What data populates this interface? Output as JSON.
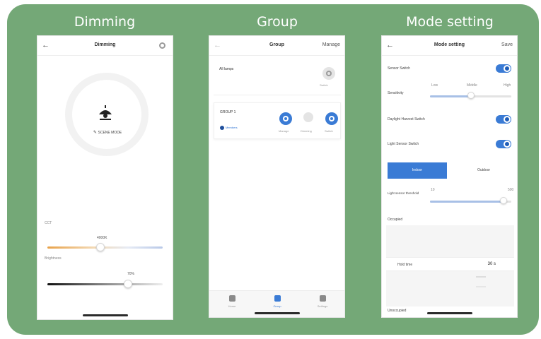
{
  "panels": {
    "dimming": {
      "title": "Dimming",
      "screen_title": "Dimming",
      "scene_label": "SCENE MODE",
      "slider1_label": "CCT",
      "slider1_value": "4000K",
      "slider1_level": 0.46,
      "slider2_label": "Brightness",
      "slider2_value": "70%",
      "slider2_level": 0.7,
      "icons": [
        "back-arrow-icon",
        "gear-icon",
        "lamp-icon"
      ]
    },
    "group": {
      "title": "Group",
      "screen_title": "Group",
      "manage_label": "Manage",
      "all_lamps_label": "All lamps",
      "all_lamps_action": "Switch",
      "group_name": "GROUP 1",
      "group_sub": "Members",
      "actions": [
        "Manage",
        "Dimming",
        "Switch"
      ],
      "tabs": [
        "Home",
        "Group",
        "Settings"
      ],
      "active_tab": "Group",
      "accent": "#3a7bd5"
    },
    "mode": {
      "title": "Mode setting",
      "screen_title": "Mode setting",
      "save_label": "Save",
      "sensor_switch": "Sensor Switch",
      "sensitivity": "Sensitivity",
      "sensitivity_levels": [
        "Low",
        "Middle",
        "High"
      ],
      "sensitivity_level": 0.5,
      "daylight": "Daylight Harvest Switch",
      "light_sensor": "Light Sensor Switch",
      "mode_options": [
        "Indoor",
        "Outdoor"
      ],
      "selected_mode": "Indoor",
      "lux_label": "Light sensor threshold",
      "lux_range": [
        "10",
        "500"
      ],
      "lux_level": 0.9,
      "occupied": "Occupied",
      "hold_time_label": "Hold time",
      "hold_time_value": "30 s",
      "unoccupied": "Unoccupied"
    }
  },
  "colors": {
    "frame": "#74a877",
    "accent": "#3a7bd5"
  }
}
